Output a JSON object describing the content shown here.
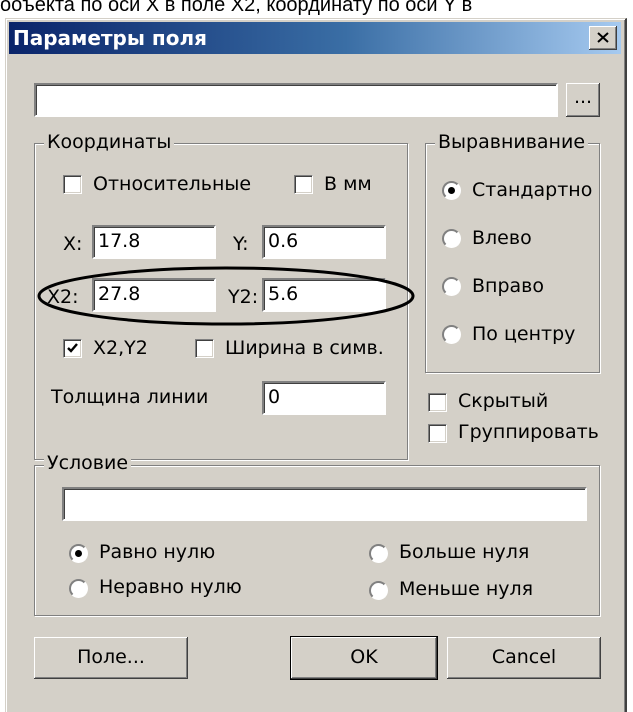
{
  "background_caption": "ооъекта по оси X в поле X2, координату по оси Y в",
  "dialog": {
    "title": "Параметры поля",
    "top_field": {
      "value": ""
    },
    "browse_button": "...",
    "coords": {
      "legend": "Координаты",
      "relative": {
        "label": "Относительные",
        "checked": false
      },
      "in_mm": {
        "label": "В мм",
        "checked": false
      },
      "x_label": "X:",
      "x_value": "17.8",
      "y_label": "Y:",
      "y_value": "0.6",
      "x2_label": "X2:",
      "x2_value": "27.8",
      "y2_label": "Y2:",
      "y2_value": "5.6",
      "x2y2": {
        "label": "X2,Y2",
        "checked": true
      },
      "char_width": {
        "label": "Ширина в симв.",
        "checked": false
      },
      "line_thickness_label": "Толщина линии",
      "line_thickness_value": "0"
    },
    "align": {
      "legend": "Выравнивание",
      "options": [
        "Стандартно",
        "Влево",
        "Вправо",
        "По центру"
      ],
      "selected": "Стандартно"
    },
    "hidden": {
      "label": "Скрытый",
      "checked": false
    },
    "group": {
      "label": "Группировать",
      "checked": false
    },
    "condition": {
      "legend": "Условие",
      "value": "",
      "options": [
        "Равно нулю",
        "Больше нуля",
        "Неравно нулю",
        "Меньше нуля"
      ],
      "selected": "Равно нулю"
    },
    "buttons": {
      "field": "Поле...",
      "ok": "OK",
      "cancel": "Cancel"
    }
  },
  "annotation": {
    "highlight": "X2 / Y2 row circled",
    "color": "#000000"
  }
}
